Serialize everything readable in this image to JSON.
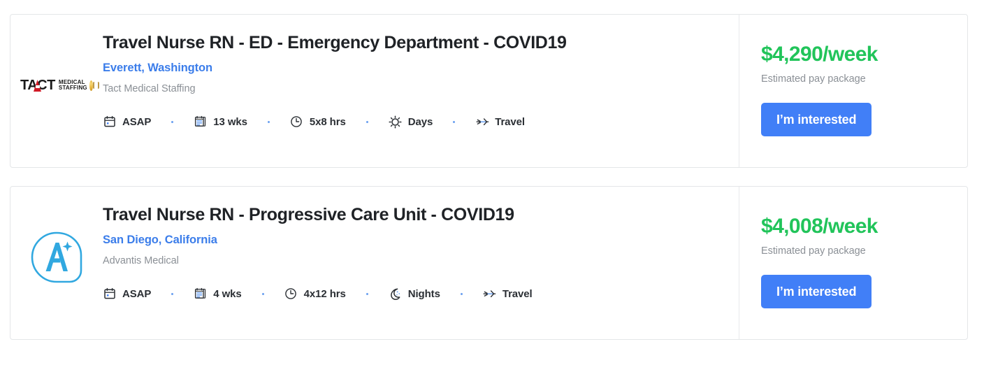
{
  "colors": {
    "accent_blue": "#417ff7",
    "link_blue": "#3b7dea",
    "pay_green": "#21c45a",
    "muted_gray": "#8b9096",
    "title_dark": "#1f2226",
    "card_border": "#e4e6e8",
    "dot_blue": "#6aa0f0"
  },
  "jobs": [
    {
      "logo": {
        "type": "tact-medical-staffing-logo",
        "wordmark": "TACT",
        "line1": "MEDICAL",
        "line2": "STAFFING"
      },
      "title": "Travel Nurse RN - ED - Emergency Department - COVID19",
      "location": "Everett, Washington",
      "company": "Tact Medical Staffing",
      "meta": [
        {
          "icon": "calendar-icon",
          "label": "ASAP"
        },
        {
          "icon": "notes-icon",
          "label": "13 wks"
        },
        {
          "icon": "clock-icon",
          "label": "5x8 hrs"
        },
        {
          "icon": "sun-icon",
          "label": "Days"
        },
        {
          "icon": "airplane-icon",
          "label": "Travel"
        }
      ],
      "pay_rate": "$4,290/week",
      "pay_caption": "Estimated pay package",
      "cta_label": "I’m interested"
    },
    {
      "logo": {
        "type": "advantis-medical-logo",
        "wordmark": "A"
      },
      "title": "Travel Nurse RN - Progressive Care Unit - COVID19",
      "location": "San Diego, California",
      "company": "Advantis Medical",
      "meta": [
        {
          "icon": "calendar-icon",
          "label": "ASAP"
        },
        {
          "icon": "notes-icon",
          "label": "4 wks"
        },
        {
          "icon": "clock-icon",
          "label": "4x12 hrs"
        },
        {
          "icon": "moon-icon",
          "label": "Nights"
        },
        {
          "icon": "airplane-icon",
          "label": "Travel"
        }
      ],
      "pay_rate": "$4,008/week",
      "pay_caption": "Estimated pay package",
      "cta_label": "I’m interested"
    }
  ]
}
